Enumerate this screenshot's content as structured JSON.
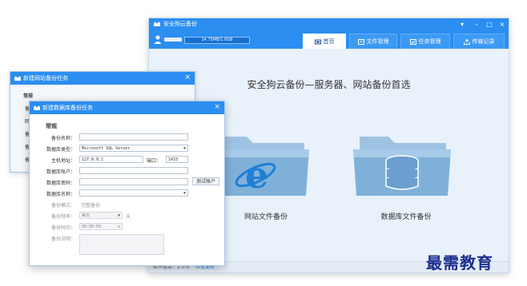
{
  "main": {
    "title": "安全狗云备份",
    "user_quota": "14.75MB/1.0GB",
    "tabs": [
      {
        "label": "首页",
        "icon": "home-icon",
        "active": true
      },
      {
        "label": "文件管理",
        "icon": "file-manager-icon",
        "active": false
      },
      {
        "label": "任务管理",
        "icon": "task-icon",
        "active": false
      },
      {
        "label": "传输记录",
        "icon": "transfer-icon",
        "active": false
      }
    ],
    "slogan": "安全狗云备份—服务器、网站备份首选",
    "cards": {
      "website": "网站文件备份",
      "database": "数据库文件备份"
    },
    "status": {
      "version": "软件版本：1.0.0",
      "check_update": "检查更新"
    }
  },
  "back_dialog": {
    "title": "新建网站备份任务",
    "rows": [
      "常规",
      "备",
      "网",
      "备",
      "备",
      "备",
      "备"
    ]
  },
  "front_dialog": {
    "title": "新建数据库备份任务",
    "section": "常规",
    "fields": {
      "backup_name_label": "备份名称：",
      "db_type_label": "数据库类型：",
      "db_type_value": "Microsoft SQL Server",
      "host_label": "主机地址：",
      "host_value": "127.0.0.1",
      "port_label": "端口：",
      "port_value": "1433",
      "db_user_label": "数据库帐户：",
      "db_password_label": "数据库密码：",
      "test_button": "测试帐户",
      "db_name_label": "数据库名称：",
      "mode_label": "备份模式：",
      "mode_value": "完整备份",
      "freq_label": "备份频率：",
      "freq_value": "每日",
      "freq_unit": "天",
      "time_label": "备份时间：",
      "time_value": "00:00:00",
      "desc_label": "备份说明："
    }
  },
  "watermark": "最需教育",
  "colors": {
    "primary": "#2b8ef0",
    "content_bg": "#e9f1fa",
    "folder": "#8fb8db",
    "watermark": "#1b2d8e"
  }
}
